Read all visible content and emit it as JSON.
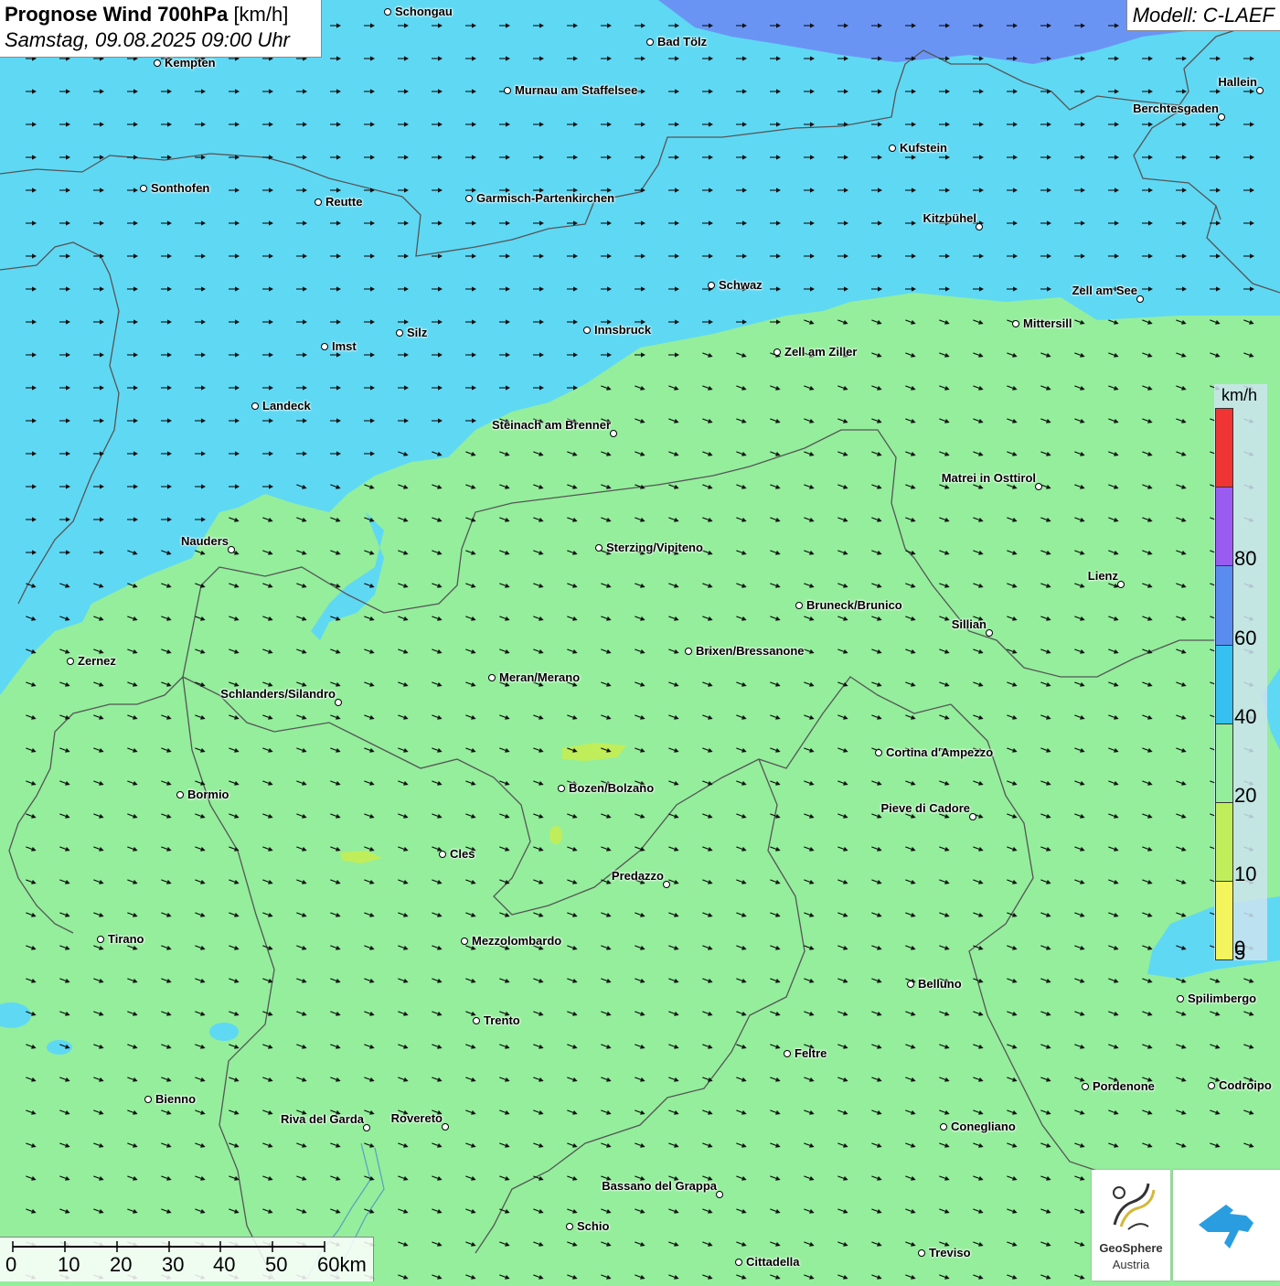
{
  "header": {
    "title": "Prognose Wind 700hPa",
    "unit": "[km/h]",
    "date": "Samstag, 09.08.2025 09:00 Uhr"
  },
  "model": "Modell: C-LAEF",
  "cities": [
    {
      "name": "Schongau"
    },
    {
      "name": "Bad Tölz"
    },
    {
      "name": "Kempten"
    },
    {
      "name": "Murnau am Staffelsee"
    },
    {
      "name": "Hallein"
    },
    {
      "name": "Berchtesgaden"
    },
    {
      "name": "Kufstein"
    },
    {
      "name": "Sonthofen"
    },
    {
      "name": "Reutte"
    },
    {
      "name": "Garmisch-Partenkirchen"
    },
    {
      "name": "Kitzbühel"
    },
    {
      "name": "Schwaz"
    },
    {
      "name": "Zell am See"
    },
    {
      "name": "Mittersill"
    },
    {
      "name": "Innsbruck"
    },
    {
      "name": "Silz"
    },
    {
      "name": "Imst"
    },
    {
      "name": "Zell am Ziller"
    },
    {
      "name": "Landeck"
    },
    {
      "name": "Steinach am Brenner"
    },
    {
      "name": "Matrei in Osttirol"
    },
    {
      "name": "Nauders"
    },
    {
      "name": "Sterzing/Vipiteno"
    },
    {
      "name": "Lienz"
    },
    {
      "name": "Bruneck/Brunico"
    },
    {
      "name": "Sillian"
    },
    {
      "name": "Zernez"
    },
    {
      "name": "Brixen/Bressanone"
    },
    {
      "name": "Meran/Merano"
    },
    {
      "name": "Schlanders/Silandro"
    },
    {
      "name": "Cortina d'Ampezzo"
    },
    {
      "name": "Bozen/Bolzano"
    },
    {
      "name": "Bormio"
    },
    {
      "name": "Pieve di Cadore"
    },
    {
      "name": "Cles"
    },
    {
      "name": "Predazzo"
    },
    {
      "name": "Tirano"
    },
    {
      "name": "Mezzolombardo"
    },
    {
      "name": "Belluno"
    },
    {
      "name": "Spilimbergo"
    },
    {
      "name": "Trento"
    },
    {
      "name": "Feltre"
    },
    {
      "name": "Pordenone"
    },
    {
      "name": "Codroipo"
    },
    {
      "name": "Bienno"
    },
    {
      "name": "Riva del Garda"
    },
    {
      "name": "Rovereto"
    },
    {
      "name": "Conegliano"
    },
    {
      "name": "Bassano del Grappa"
    },
    {
      "name": "Schio"
    },
    {
      "name": "Treviso"
    },
    {
      "name": "Cittadella"
    }
  ],
  "legend": {
    "unit": "km/h",
    "stops": [
      {
        "label": "",
        "color": "#f03434"
      },
      {
        "label": "80",
        "color": "#9a5cf0"
      },
      {
        "label": "60",
        "color": "#5a8cf0"
      },
      {
        "label": "40",
        "color": "#36c0f0"
      },
      {
        "label": "20",
        "color": "#94ee9c"
      },
      {
        "label": "10",
        "color": "#c0ee5a"
      },
      {
        "label": "5",
        "color": "#f4f45c"
      }
    ],
    "bottom_label": "0"
  },
  "scale_bar": {
    "labels": [
      "0",
      "10",
      "20",
      "30",
      "40",
      "50",
      "60km"
    ]
  },
  "logos": {
    "geosphere": {
      "line1": "GeoSphere",
      "line2": "Austria"
    }
  },
  "colors": {
    "wind_10_20": "#94ee9c",
    "wind_20_40": "#5fd8f4",
    "wind_40_60": "#6a94f4",
    "border": "#555555"
  },
  "wind": {
    "north_zone_direction": "east",
    "south_zone_direction": "east-south-east"
  }
}
